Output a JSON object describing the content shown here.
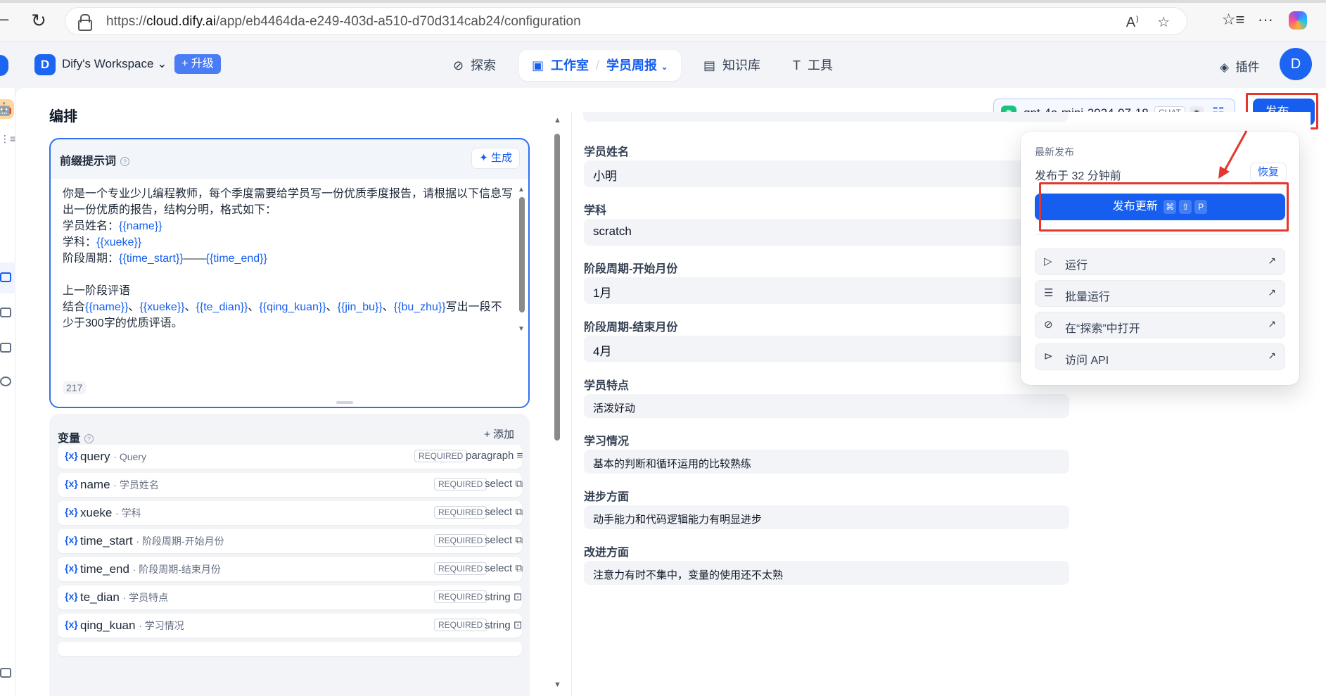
{
  "browser": {
    "url_prefix": "https://",
    "url_host": "cloud.dify.ai",
    "url_path": "/app/eb4464da-e249-403d-a510-d70d314cab24/configuration"
  },
  "header": {
    "workspace_initial": "D",
    "workspace_name": "Dify's Workspace",
    "upgrade_label": "升级",
    "nav": {
      "explore": "探索",
      "studio": "工作室",
      "app_name": "学员周报",
      "knowledge": "知识库",
      "tools": "工具"
    },
    "plugins": "插件",
    "avatar": "D"
  },
  "page": {
    "title": "编排",
    "model_name": "gpt-4o-mini-2024-07-18",
    "model_mode": "CHAT",
    "publish_label": "发布"
  },
  "prompt": {
    "title": "前缀提示词",
    "generate_label": "生成",
    "line1": "你是一个专业少儿编程教师，每个季度需要给学员写一份优质季度报告，请根据以下信息写出一份优质的报告，结构分明，格式如下：",
    "name_label": "学员姓名：",
    "name_var": "{{name}}",
    "xueke_label": "学科：",
    "xueke_var": "{{xueke}}",
    "period_label": "阶段周期：",
    "time_start_var": "{{time_start}}",
    "dash": "——",
    "time_end_var": "{{time_end}}",
    "review_heading": "上一阶段评语",
    "combine": "结合",
    "v_name": "{{name}}",
    "v_xueke": "{{xueke}}",
    "v_te_dian": "{{te_dian}}",
    "v_qing_kuan": "{{qing_kuan}}",
    "v_jin_bu": "{{jin_bu}}",
    "v_bu_zhu": "{{bu_zhu}}",
    "sep": "、",
    "tail": "写出一段不少于300字的优质评语。",
    "char_count": "217"
  },
  "variables": {
    "title": "变量",
    "add_label": "添加",
    "symbol": "{x}",
    "required_label": "REQUIRED",
    "rows": [
      {
        "key": "query",
        "label": "Query",
        "type": "paragraph"
      },
      {
        "key": "name",
        "label": "学员姓名",
        "type": "select"
      },
      {
        "key": "xueke",
        "label": "学科",
        "type": "select"
      },
      {
        "key": "time_start",
        "label": "阶段周期-开始月份",
        "type": "select"
      },
      {
        "key": "time_end",
        "label": "阶段周期-结束月份",
        "type": "select"
      },
      {
        "key": "te_dian",
        "label": "学员特点",
        "type": "string"
      },
      {
        "key": "qing_kuan",
        "label": "学习情况",
        "type": "string"
      }
    ]
  },
  "debug": {
    "fields": [
      {
        "label": "学员姓名",
        "value": "小明"
      },
      {
        "label": "学科",
        "value": "scratch"
      },
      {
        "label": "阶段周期-开始月份",
        "value": "1月"
      },
      {
        "label": "阶段周期-结束月份",
        "value": "4月"
      },
      {
        "label": "学员特点",
        "value": "活泼好动"
      },
      {
        "label": "学习情况",
        "value": "基本的判断和循环运用的比较熟练"
      },
      {
        "label": "进步方面",
        "value": "动手能力和代码逻辑能力有明显进步"
      },
      {
        "label": "改进方面",
        "value": "注意力有时不集中，变量的使用还不太熟"
      }
    ]
  },
  "popover": {
    "latest": "最新发布",
    "published_ago": "发布于 32 分钟前",
    "restore": "恢复",
    "update": "发布更新",
    "kbd1": "⌘",
    "kbd2": "⇧",
    "kbd3": "P",
    "items": [
      {
        "label": "运行"
      },
      {
        "label": "批量运行"
      },
      {
        "label": "在“探索”中打开"
      },
      {
        "label": "访问 API"
      }
    ]
  },
  "colors": {
    "primary": "#155eef",
    "annotation_red": "#e5352d"
  }
}
